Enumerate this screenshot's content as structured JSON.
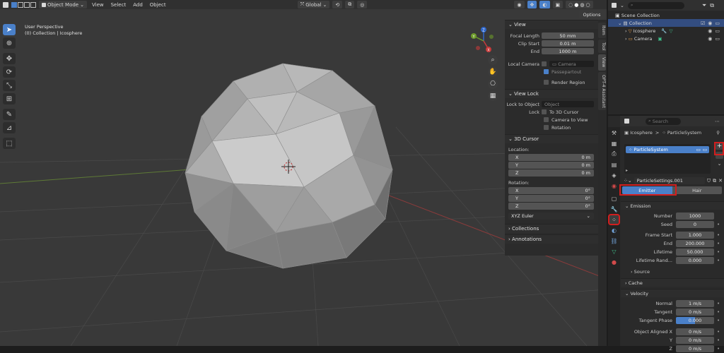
{
  "viewport": {
    "mode_label": "Object Mode",
    "menus": [
      "View",
      "Select",
      "Add",
      "Object"
    ],
    "transform_orientation": "Global",
    "overlay_title": "User Perspective",
    "overlay_sub": "(0) Collection | Icosphere",
    "options_label": "Options",
    "axis_labels": {
      "x": "X",
      "y": "Y",
      "z": "Z"
    }
  },
  "side_tabs": [
    "Item",
    "Tool",
    "View",
    "OPT-4 Assistant"
  ],
  "npanel": {
    "view_section": "View",
    "focal_length_label": "Focal Length",
    "focal_length": "50 mm",
    "clip_start_label": "Clip Start",
    "clip_start": "0.01 m",
    "end_label": "End",
    "clip_end": "1000 m",
    "local_camera_label": "Local Camera",
    "camera_placeholder": "Camera",
    "passepartout": "Passepartout",
    "render_region": "Render Region",
    "view_lock_section": "View Lock",
    "lock_to_object_label": "Lock to Object",
    "object_placeholder": "Object",
    "lock_label": "Lock",
    "to_3d_cursor": "To 3D Cursor",
    "camera_to_view": "Camera to View",
    "rotation_lock": "Rotation",
    "cursor_section": "3D Cursor",
    "location_label": "Location:",
    "loc_x_label": "X",
    "loc_x": "0 m",
    "loc_y_label": "Y",
    "loc_y": "0 m",
    "loc_z_label": "Z",
    "loc_z": "0 m",
    "rotation_label": "Rotation:",
    "rot_x_label": "X",
    "rot_x": "0°",
    "rot_y_label": "Y",
    "rot_y": "0°",
    "rot_z_label": "Z",
    "rot_z": "0°",
    "rotation_mode": "XYZ Euler",
    "collections_section": "Collections",
    "annotations_section": "Annotations"
  },
  "outliner": {
    "search_placeholder": "",
    "scene_collection": "Scene Collection",
    "collection": "Collection",
    "icosphere": "Icosphere",
    "camera": "Camera"
  },
  "properties": {
    "search_placeholder": "Search",
    "breadcrumb_object": "Icosphere",
    "breadcrumb_sep": ">",
    "breadcrumb_system": "ParticleSystem",
    "particle_system_item": "ParticleSystem",
    "settings_name": "ParticleSettings.001",
    "emitter_label": "Emitter",
    "hair_label": "Hair",
    "emission_section": "Emission",
    "number_label": "Number",
    "number": "1000",
    "seed_label": "Seed",
    "seed": "0",
    "frame_start_label": "Frame Start",
    "frame_start": "1.000",
    "end_label": "End",
    "end": "200.000",
    "lifetime_label": "Lifetime",
    "lifetime": "50.000",
    "lifetime_random_label": "Lifetime Rand...",
    "lifetime_random": "0.000",
    "source_section": "Source",
    "cache_section": "Cache",
    "velocity_section": "Velocity",
    "normal_label": "Normal",
    "normal": "1 m/s",
    "tangent_label": "Tangent",
    "tangent": "0 m/s",
    "tangent_phase_label": "Tangent Phase",
    "tangent_phase": "0.000",
    "object_aligned_x_label": "Object Aligned X",
    "object_aligned_x": "0 m/s",
    "obj_y_label": "Y",
    "obj_y": "0 m/s",
    "obj_z_label": "Z",
    "obj_z": "0 m/s"
  },
  "colors": {
    "accent": "#4a80c9",
    "highlight_box": "#d21e1e",
    "selection": "#334d80",
    "mesh_face": "#a8a8a8"
  }
}
